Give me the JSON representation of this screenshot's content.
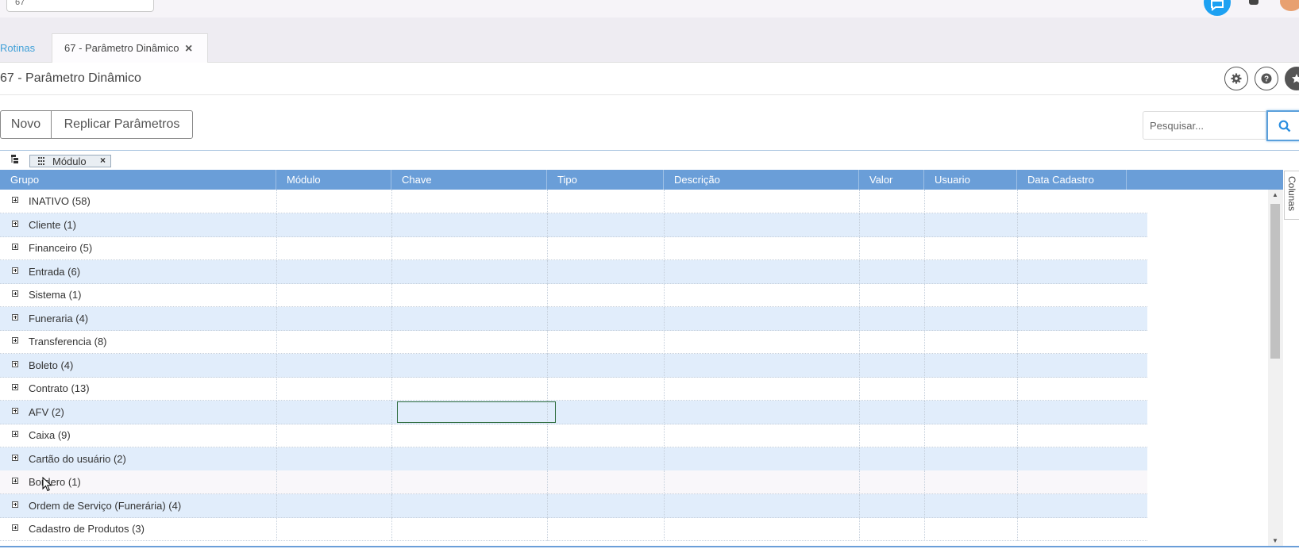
{
  "topbar": {
    "search_value": "67"
  },
  "tabs": {
    "link_label": "Rotinas",
    "active_label": "67 - Parâmetro Dinâmico",
    "close_glyph": "×"
  },
  "page": {
    "title": "67 - Parâmetro Dinâmico"
  },
  "toolbar": {
    "novo_label": "Novo",
    "replicar_label": "Replicar Parâmetros",
    "search_placeholder": "Pesquisar..."
  },
  "grouping": {
    "chip_label": "Módulo",
    "chip_close": "×"
  },
  "grid": {
    "columns": [
      "Grupo",
      "Módulo",
      "Chave",
      "Tipo",
      "Descrição",
      "Valor",
      "Usuario",
      "Data Cadastro"
    ],
    "rows": [
      "INATIVO (58)",
      "Cliente (1)",
      "Financeiro (5)",
      "Entrada (6)",
      "Sistema (1)",
      "Funeraria (4)",
      "Transferencia (8)",
      "Boleto (4)",
      "Contrato (13)",
      "AFV (2)",
      "Caixa (9)",
      "Cartão do usuário (2)",
      "Bordero (1)",
      "Ordem de Serviço (Funerária) (4)",
      "Cadastro de Produtos (3)"
    ]
  },
  "side_panel": {
    "columns_label": "Colunas"
  },
  "colors": {
    "header_bg": "#6a9ed8",
    "alt_row_bg": "#e1edfb",
    "accent": "#1da1f2"
  }
}
